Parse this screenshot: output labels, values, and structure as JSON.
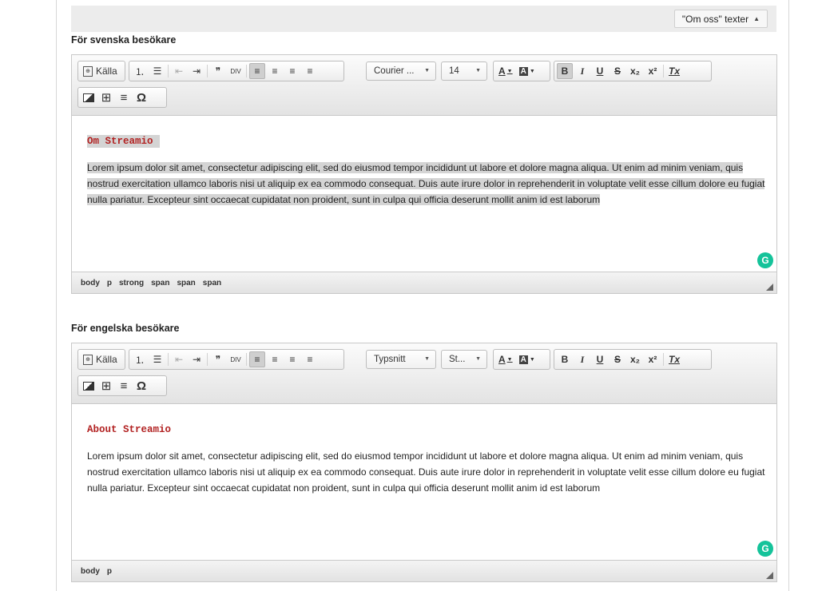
{
  "header": {
    "toggle_label": "\"Om oss\" texter",
    "toggle_icon": "triangle-up-icon"
  },
  "editors": [
    {
      "label": "För svenska besökare",
      "toolbar": {
        "source_label": "Källa",
        "font_combo": "Courier ...",
        "size_combo": "14"
      },
      "heading": "Om Streamio",
      "paragraph": "Lorem ipsum dolor sit amet, consectetur adipiscing elit, sed do eiusmod tempor incididunt ut labore et dolore magna aliqua. Ut enim ad minim veniam, quis nostrud exercitation ullamco laboris nisi ut aliquip ex ea commodo consequat. Duis aute irure dolor in reprehenderit in voluptate velit esse cillum dolore eu fugiat nulla pariatur. Excepteur sint occaecat cupidatat non proident, sunt in culpa qui officia deserunt mollit anim id est laborum",
      "path": [
        "body",
        "p",
        "strong",
        "span",
        "span",
        "span"
      ]
    },
    {
      "label": "För engelska besökare",
      "toolbar": {
        "source_label": "Källa",
        "font_combo": "Typsnitt",
        "size_combo": "St..."
      },
      "heading": "About Streamio",
      "paragraph": "Lorem ipsum dolor sit amet, consectetur adipiscing elit, sed do eiusmod tempor incididunt ut labore et dolore magna aliqua. Ut enim ad minim veniam, quis nostrud exercitation ullamco laboris nisi ut aliquip ex ea commodo consequat. Duis aute irure dolor in reprehenderit in voluptate velit esse cillum dolore eu fugiat nulla pariatur. Excepteur sint occaecat cupidatat non proident, sunt in culpa qui officia deserunt mollit anim id est laborum",
      "path": [
        "body",
        "p"
      ]
    }
  ],
  "toolbar_glyphs": {
    "blockquote": "❞",
    "div": "DIV",
    "bold": "B",
    "italic": "I",
    "underline": "U",
    "strike": "S",
    "subscript": "x₂",
    "superscript": "x²",
    "remove_format": "Tx",
    "text_color": "A",
    "bg_color": "A",
    "table": "⊞",
    "hr": "≡",
    "special_char": "Ω"
  },
  "colors": {
    "accent_red": "#b22222",
    "grammarly": "#15c39a"
  }
}
